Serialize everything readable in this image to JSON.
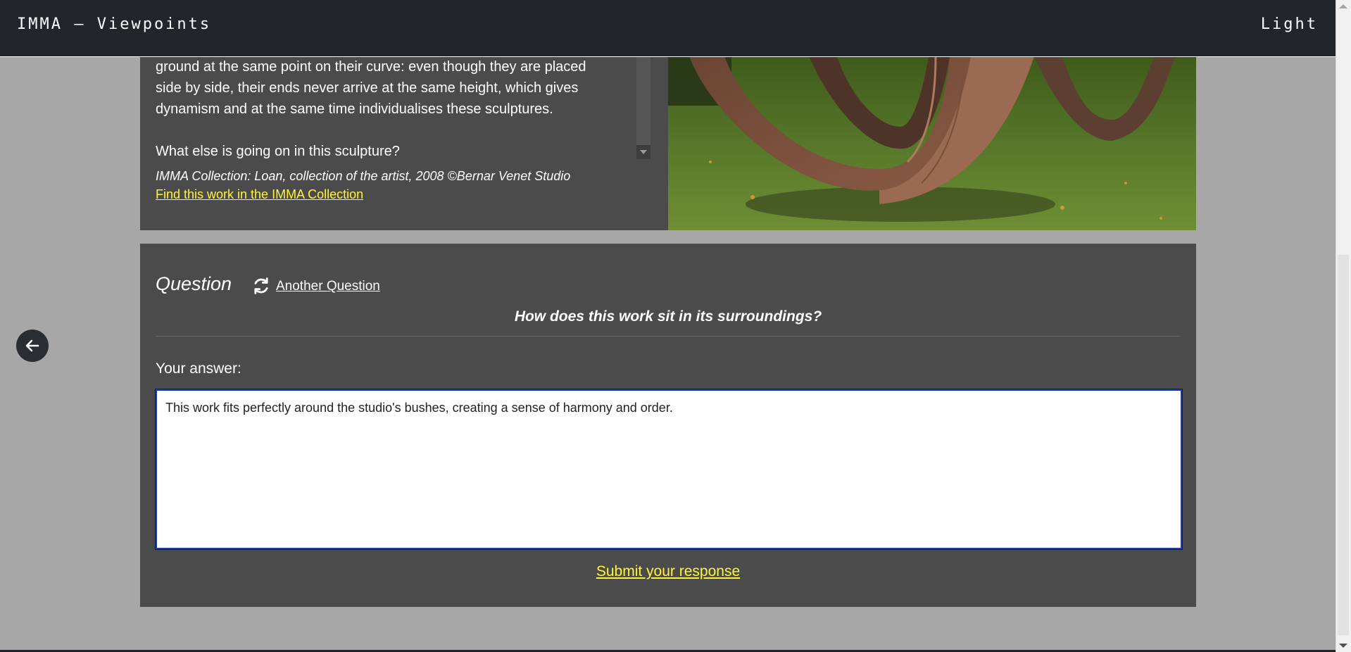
{
  "app": {
    "title": "IMMA – Viewpoints",
    "theme_toggle": "Light"
  },
  "artwork": {
    "description_lines": [
      "ground at the same point on their curve: even though they are placed",
      "side by side, their ends never arrive at the same height, which gives",
      "dynamism and at the same time individualises these sculptures.",
      "",
      "What else is going on in this sculpture?"
    ],
    "credit": "IMMA Collection: Loan, collection of the artist, 2008 ©Bernar Venet Studio",
    "collection_link": "Find this work in the IMMA Collection"
  },
  "question": {
    "heading": "Question",
    "another_label": "Another Question",
    "text": "How does this work sit in its surroundings?",
    "answer_label": "Your answer:",
    "answer_value": "This work fits perfectly around the studio's bushes, creating a sense of harmony and order.",
    "submit_label": "Submit your response"
  },
  "icons": {
    "back": "arrow-left-icon",
    "refresh": "refresh-icon"
  },
  "colors": {
    "topbar": "#22262b",
    "card": "#4b4b4b",
    "page": "#a7a7a7",
    "link": "#fff33b"
  }
}
